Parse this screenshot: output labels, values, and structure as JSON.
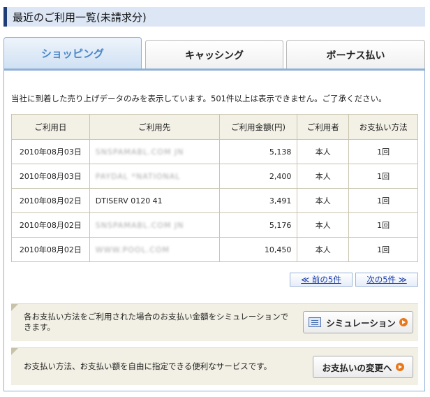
{
  "header": {
    "title": "最近のご利用一覧(未請求分)"
  },
  "tabs": [
    {
      "label": "ショッピング",
      "active": true
    },
    {
      "label": "キャッシング",
      "active": false
    },
    {
      "label": "ボーナス払い",
      "active": false
    }
  ],
  "notice": "当社に到着した売り上げデータのみを表示しています。501件以上は表示できません。ご了承ください。",
  "table": {
    "columns": [
      "ご利用日",
      "ご利用先",
      "ご利用金額(円)",
      "ご利用者",
      "お支払い方法"
    ],
    "rows": [
      {
        "date": "2010年08月03日",
        "merchant": "SNSPAMABL.COM JN",
        "amount": "5,138",
        "user": "本人",
        "method": "1回"
      },
      {
        "date": "2010年08月03日",
        "merchant": "PAYDAL *NATIONAL",
        "amount": "2,400",
        "user": "本人",
        "method": "1回"
      },
      {
        "date": "2010年08月02日",
        "merchant": "DTISERV  0120  41",
        "amount": "3,491",
        "user": "本人",
        "method": "1回"
      },
      {
        "date": "2010年08月02日",
        "merchant": "SNSPAMABL.COM JN",
        "amount": "5,176",
        "user": "本人",
        "method": "1回"
      },
      {
        "date": "2010年08月02日",
        "merchant": "WWW.POOL.COM",
        "amount": "10,450",
        "user": "本人",
        "method": "1回"
      }
    ]
  },
  "pager": {
    "prev_label": "≪ 前の5件",
    "next_label": "次の5件 ≫"
  },
  "simulation": {
    "text": "各お支払い方法をご利用された場合のお支払い金額をシミュレーションできます。",
    "button_label": "シミュレーション"
  },
  "payment_change": {
    "text": "お支払い方法、お支払い額を自由に指定できる便利なサービスです。",
    "button_label": "お支払いの変更へ"
  },
  "colors": {
    "header_bar": "#1e3c78",
    "active_tab_text": "#4a86c8",
    "accent_orange": "#e8781e",
    "link_blue": "#1a3aa8"
  }
}
